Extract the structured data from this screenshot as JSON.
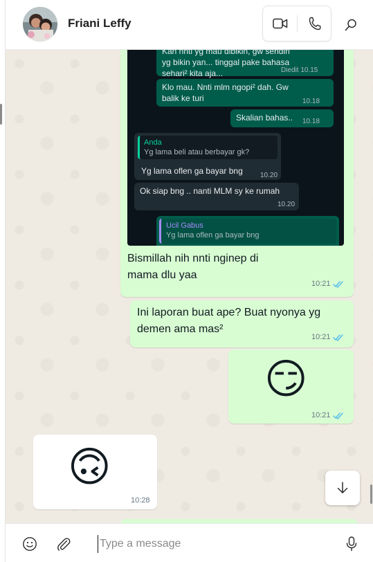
{
  "header": {
    "contact_name": "Friani Leffy"
  },
  "screenshot": {
    "messages": [
      {
        "text": "Kan nnti yg mau dibikin, gw sendiri yg bikin yan... tinggal pake bahasa sehari² kita aja...",
        "meta": "Diedit 10.15"
      },
      {
        "text": "Klo mau. Nnti mlm ngopi² dah. Gw balik ke turi",
        "meta": "10.18"
      },
      {
        "text": "Skalian bahas..",
        "meta": "10.18"
      },
      {
        "quote_name": "Anda",
        "quote_text": "Yg lama beli atau berbayar gk?",
        "text": "Yg lama oflen ga bayar bng",
        "meta": "10.20"
      },
      {
        "text": "Ok siap bng .. nanti MLM sy ke rumah",
        "meta": "10.20"
      },
      {
        "quote_name": "Ucil Gabus",
        "quote_text": "Yg lama oflen ga bayar bng"
      }
    ]
  },
  "messages": [
    {
      "text_line1": "Bismillah nih nnti nginep di",
      "text_line2": "mama dlu yaa",
      "time": "10:21"
    },
    {
      "text_line1": "Ini laporan buat ape? Buat nyonya yg",
      "text_line2": "demen ama mas²",
      "time": "10:21"
    },
    {
      "emoji": "😏",
      "time": "10:21"
    },
    {
      "emoji": "🙃",
      "time": "10:28"
    }
  ],
  "composer": {
    "placeholder": "Type a message"
  },
  "colors": {
    "outgoing_bubble": "#d9fdd3",
    "incoming_bubble": "#ffffff",
    "read_ticks": "#53bdeb",
    "chat_background": "#efeae2"
  },
  "icons": [
    "video-call-icon",
    "voice-call-icon",
    "search-icon",
    "emoji-icon",
    "attach-icon",
    "microphone-icon",
    "arrow-down-icon",
    "double-check-icon"
  ]
}
